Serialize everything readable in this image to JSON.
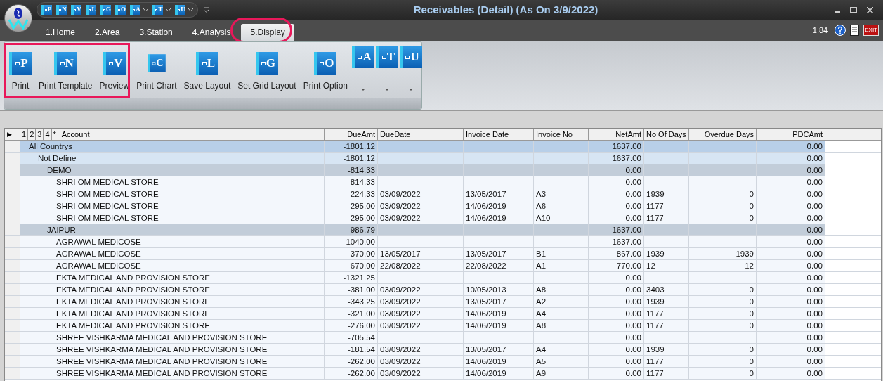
{
  "window": {
    "title": "Receivables (Detail) (As On 3/9/2022)"
  },
  "quick_access": [
    {
      "letter": "P",
      "dropdown": false
    },
    {
      "letter": "N",
      "dropdown": false
    },
    {
      "letter": "V",
      "dropdown": false
    },
    {
      "letter": "L",
      "dropdown": false
    },
    {
      "letter": "G",
      "dropdown": false
    },
    {
      "letter": "O",
      "dropdown": false
    },
    {
      "letter": "A",
      "dropdown": true
    },
    {
      "letter": "T",
      "dropdown": true
    },
    {
      "letter": "U",
      "dropdown": true
    }
  ],
  "tabs": [
    {
      "label": "1.Home",
      "selected": false
    },
    {
      "label": "2.Area",
      "selected": false
    },
    {
      "label": "3.Station",
      "selected": false
    },
    {
      "label": "4.Analysis",
      "selected": false
    },
    {
      "label": "5.Display",
      "selected": true
    }
  ],
  "version": "1.84",
  "exit_label": "EXIT",
  "ribbon": [
    {
      "label": "Print",
      "letter": "P",
      "kind": "large"
    },
    {
      "label": "Print Template",
      "letter": "N",
      "kind": "large"
    },
    {
      "label": "Preview",
      "letter": "V",
      "kind": "large"
    },
    {
      "label": "Print Chart",
      "letter": "C",
      "kind": "small"
    },
    {
      "label": "Save Layout",
      "letter": "L",
      "kind": "large"
    },
    {
      "label": "Set Grid Layout",
      "letter": "G",
      "kind": "large"
    },
    {
      "label": "Print Option",
      "letter": "O",
      "kind": "large"
    },
    {
      "letter": "A",
      "kind": "dropdown"
    },
    {
      "letter": "T",
      "kind": "dropdown"
    },
    {
      "letter": "U",
      "kind": "dropdown"
    }
  ],
  "table": {
    "row_indicator": "▶",
    "levels": [
      "1",
      "2",
      "3",
      "4",
      "*"
    ],
    "columns": [
      "Account",
      "DueAmt",
      "DueDate",
      "Invoice Date",
      "Invoice No",
      "NetAmt",
      "No Of Days",
      "Overdue Days",
      "PDCAmt"
    ],
    "rows": [
      {
        "account": "All Countrys",
        "due_amt": "-1801.12",
        "net_amt": "1637.00",
        "pdc_amt": "0.00",
        "children": [
          {
            "account": "Not Define",
            "due_amt": "-1801.12",
            "net_amt": "1637.00",
            "pdc_amt": "0.00",
            "children": [
              {
                "account": "DEMO",
                "due_amt": "-814.33",
                "net_amt": "0.00",
                "pdc_amt": "0.00",
                "children": [
                  {
                    "account": "SHRI OM MEDICAL STORE",
                    "due_amt": "-814.33",
                    "net_amt": "0.00",
                    "pdc_amt": "0.00",
                    "invoices": [
                      {
                        "account": "SHRI OM MEDICAL STORE",
                        "due_amt": "-224.33",
                        "due_date": "03/09/2022",
                        "invoice_date": "13/05/2017",
                        "invoice_no": "A3",
                        "net_amt": "0.00",
                        "no_of_days": "1939",
                        "overdue_days": "0",
                        "pdc_amt": "0.00"
                      },
                      {
                        "account": "SHRI OM MEDICAL STORE",
                        "due_amt": "-295.00",
                        "due_date": "03/09/2022",
                        "invoice_date": "14/06/2019",
                        "invoice_no": "A6",
                        "net_amt": "0.00",
                        "no_of_days": "1177",
                        "overdue_days": "0",
                        "pdc_amt": "0.00"
                      },
                      {
                        "account": "SHRI OM MEDICAL STORE",
                        "due_amt": "-295.00",
                        "due_date": "03/09/2022",
                        "invoice_date": "14/06/2019",
                        "invoice_no": "A10",
                        "net_amt": "0.00",
                        "no_of_days": "1177",
                        "overdue_days": "0",
                        "pdc_amt": "0.00"
                      }
                    ]
                  }
                ]
              },
              {
                "account": "JAIPUR",
                "due_amt": "-986.79",
                "net_amt": "1637.00",
                "pdc_amt": "0.00",
                "children": [
                  {
                    "account": "AGRAWAL MEDICOSE",
                    "due_amt": "1040.00",
                    "net_amt": "1637.00",
                    "pdc_amt": "0.00",
                    "invoices": [
                      {
                        "account": "AGRAWAL MEDICOSE",
                        "due_amt": "370.00",
                        "due_date": "13/05/2017",
                        "invoice_date": "13/05/2017",
                        "invoice_no": "B1",
                        "net_amt": "867.00",
                        "no_of_days": "1939",
                        "overdue_days": "1939",
                        "pdc_amt": "0.00"
                      },
                      {
                        "account": "AGRAWAL MEDICOSE",
                        "due_amt": "670.00",
                        "due_date": "22/08/2022",
                        "invoice_date": "22/08/2022",
                        "invoice_no": "A1",
                        "net_amt": "770.00",
                        "no_of_days": "12",
                        "overdue_days": "12",
                        "pdc_amt": "0.00"
                      }
                    ]
                  },
                  {
                    "account": "EKTA MEDICAL AND PROVISION STORE",
                    "due_amt": "-1321.25",
                    "net_amt": "0.00",
                    "pdc_amt": "0.00",
                    "invoices": [
                      {
                        "account": "EKTA MEDICAL AND PROVISION STORE",
                        "due_amt": "-381.00",
                        "due_date": "03/09/2022",
                        "invoice_date": "10/05/2013",
                        "invoice_no": "A8",
                        "net_amt": "0.00",
                        "no_of_days": "3403",
                        "overdue_days": "0",
                        "pdc_amt": "0.00"
                      },
                      {
                        "account": "EKTA MEDICAL AND PROVISION STORE",
                        "due_amt": "-343.25",
                        "due_date": "03/09/2022",
                        "invoice_date": "13/05/2017",
                        "invoice_no": "A2",
                        "net_amt": "0.00",
                        "no_of_days": "1939",
                        "overdue_days": "0",
                        "pdc_amt": "0.00"
                      },
                      {
                        "account": "EKTA MEDICAL AND PROVISION STORE",
                        "due_amt": "-321.00",
                        "due_date": "03/09/2022",
                        "invoice_date": "14/06/2019",
                        "invoice_no": "A4",
                        "net_amt": "0.00",
                        "no_of_days": "1177",
                        "overdue_days": "0",
                        "pdc_amt": "0.00"
                      },
                      {
                        "account": "EKTA MEDICAL AND PROVISION STORE",
                        "due_amt": "-276.00",
                        "due_date": "03/09/2022",
                        "invoice_date": "14/06/2019",
                        "invoice_no": "A8",
                        "net_amt": "0.00",
                        "no_of_days": "1177",
                        "overdue_days": "0",
                        "pdc_amt": "0.00"
                      }
                    ]
                  },
                  {
                    "account": "SHREE VISHKARMA MEDICAL AND PROVISION STORE",
                    "due_amt": "-705.54",
                    "net_amt": "0.00",
                    "pdc_amt": "0.00",
                    "invoices": [
                      {
                        "account": "SHREE VISHKARMA MEDICAL AND PROVISION STORE",
                        "due_amt": "-181.54",
                        "due_date": "03/09/2022",
                        "invoice_date": "13/05/2017",
                        "invoice_no": "A4",
                        "net_amt": "0.00",
                        "no_of_days": "1939",
                        "overdue_days": "0",
                        "pdc_amt": "0.00"
                      },
                      {
                        "account": "SHREE VISHKARMA MEDICAL AND PROVISION STORE",
                        "due_amt": "-262.00",
                        "due_date": "03/09/2022",
                        "invoice_date": "14/06/2019",
                        "invoice_no": "A5",
                        "net_amt": "0.00",
                        "no_of_days": "1177",
                        "overdue_days": "0",
                        "pdc_amt": "0.00"
                      },
                      {
                        "account": "SHREE VISHKARMA MEDICAL AND PROVISION STORE",
                        "due_amt": "-262.00",
                        "due_date": "03/09/2022",
                        "invoice_date": "14/06/2019",
                        "invoice_no": "A9",
                        "net_amt": "0.00",
                        "no_of_days": "1177",
                        "overdue_days": "0",
                        "pdc_amt": "0.00"
                      }
                    ]
                  }
                ]
              }
            ]
          }
        ]
      }
    ]
  }
}
